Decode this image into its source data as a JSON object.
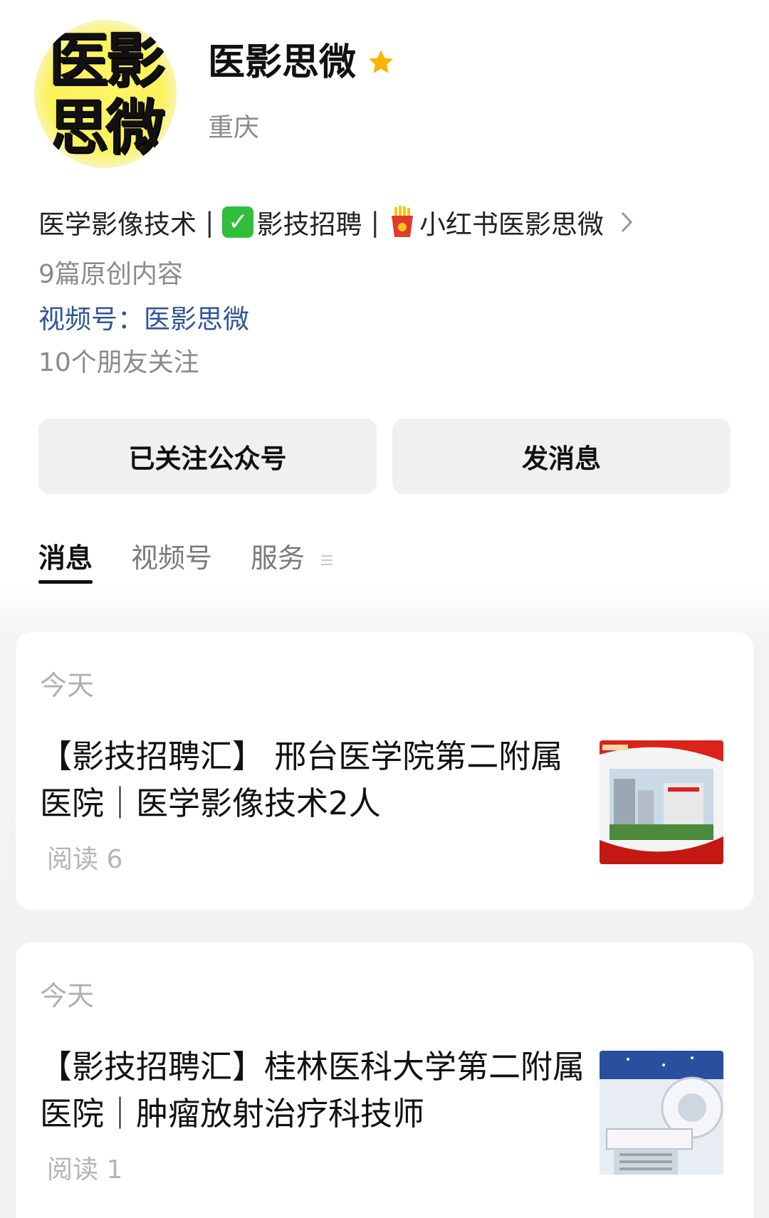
{
  "profile": {
    "avatar_text_line1": "医影",
    "avatar_text_line2": "思微",
    "name": "医影思微",
    "location": "重庆",
    "bio_part1": "医学影像技术",
    "bio_sep": "|",
    "bio_part2": "影技招聘",
    "bio_part3": "小红书医影思微",
    "original_count": "9篇原创内容",
    "channel_link": "视频号：医影思微",
    "friends_follow": "10个朋友关注"
  },
  "actions": {
    "follow_label": "已关注公众号",
    "message_label": "发消息"
  },
  "tabs": [
    {
      "label": "消息",
      "active": true
    },
    {
      "label": "视频号",
      "active": false
    },
    {
      "label": "服务",
      "active": false
    }
  ],
  "articles": [
    {
      "date": "今天",
      "title": "【影技招聘汇】 邢台医学院第二附属医院｜医学影像技术2人",
      "reads": "阅读 6"
    },
    {
      "date": "今天",
      "title": "【影技招聘汇】桂林医科大学第二附属医院｜肿瘤放射治疗科技师",
      "reads": "阅读 1"
    }
  ],
  "colors": {
    "star": "#f7b500",
    "link": "#2f5696",
    "check": "#2fbf3a"
  },
  "icons": [
    "star-icon",
    "check-icon",
    "fries-icon",
    "chevron-right-icon",
    "menu-lines-icon"
  ]
}
